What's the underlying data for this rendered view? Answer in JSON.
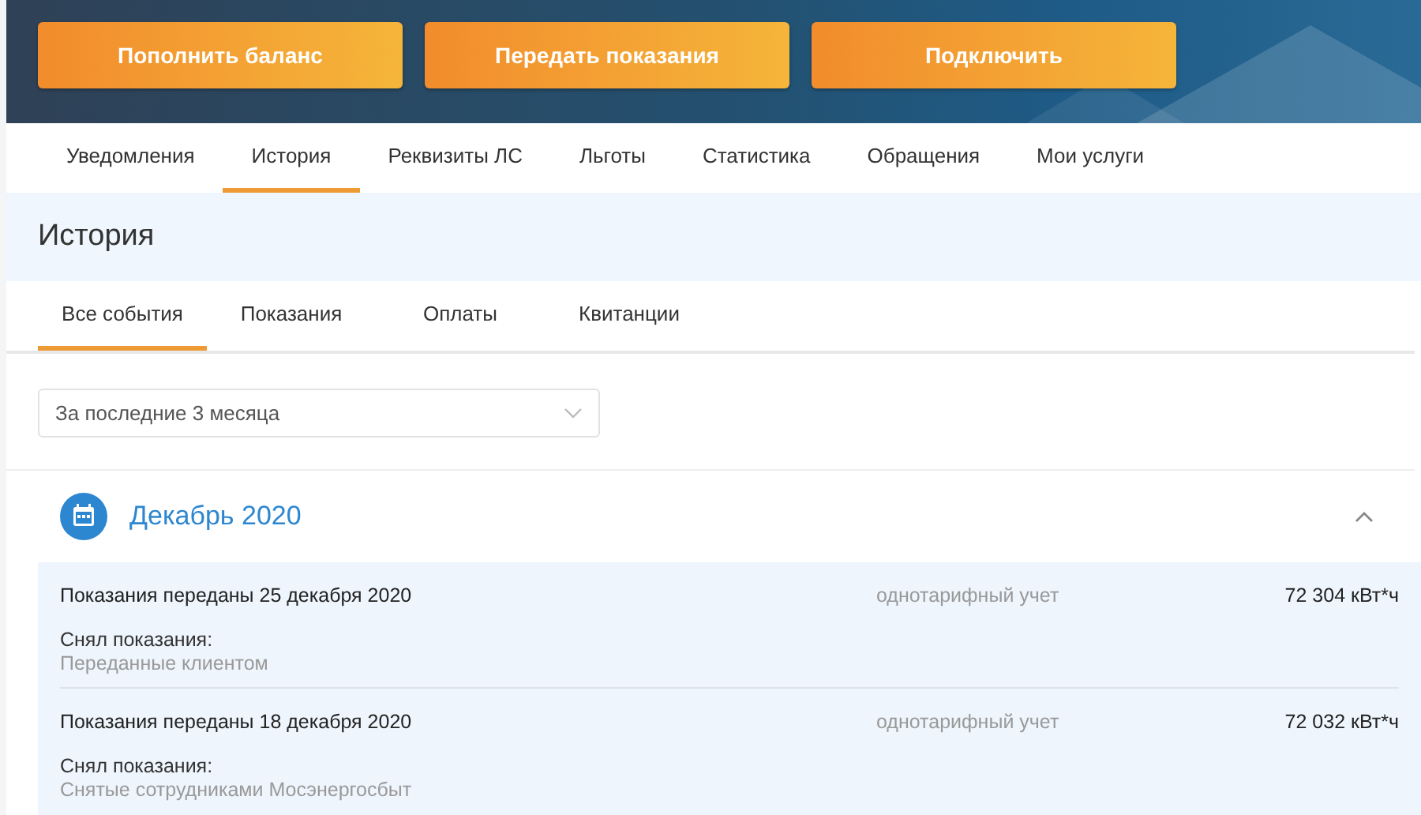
{
  "action_buttons": [
    {
      "label": "Пополнить баланс"
    },
    {
      "label": "Передать показания"
    },
    {
      "label": "Подключить"
    }
  ],
  "nav_tabs": [
    {
      "label": "Уведомления",
      "selected": false
    },
    {
      "label": "История",
      "selected": true
    },
    {
      "label": "Реквизиты ЛС",
      "selected": false
    },
    {
      "label": "Льготы",
      "selected": false
    },
    {
      "label": "Статистика",
      "selected": false
    },
    {
      "label": "Обращения",
      "selected": false
    },
    {
      "label": "Мои услуги",
      "selected": false
    }
  ],
  "page_title": "История",
  "sub_tabs": [
    {
      "label": "Все события",
      "selected": true
    },
    {
      "label": "Показания",
      "selected": false
    },
    {
      "label": "Оплаты",
      "selected": false
    },
    {
      "label": "Квитанции",
      "selected": false
    }
  ],
  "period_select": {
    "value": "За последние 3 месяца"
  },
  "month_group": {
    "title": "Декабрь 2020",
    "expanded": true,
    "entries": [
      {
        "title": "Показания переданы 25 декабря 2020",
        "taker_label": "Снял показания:",
        "taker": "Переданные клиентом",
        "tariff": "однотарифный учет",
        "reading": "72 304 кВт*ч"
      },
      {
        "title": "Показания переданы 18 декабря 2020",
        "taker_label": "Снял показания:",
        "taker": "Снятые сотрудниками Мосэнергосбыт",
        "tariff": "однотарифный учет",
        "reading": "72 032 кВт*ч"
      }
    ]
  }
}
